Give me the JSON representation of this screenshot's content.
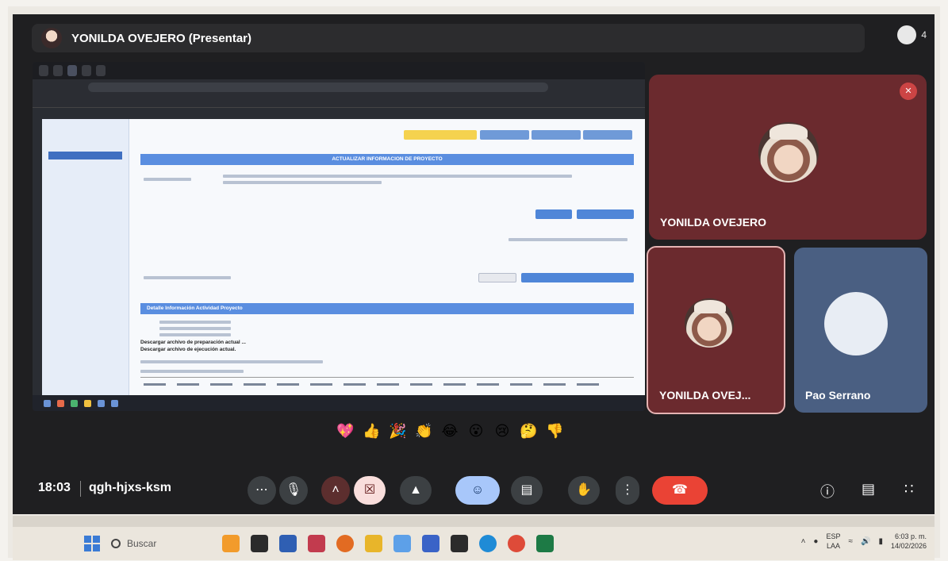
{
  "header": {
    "presenter_label": "YONILDA OVEJERO (Presentar)",
    "people_count": "4"
  },
  "shared_screen": {
    "banner_title": "ACTUALIZAR INFORMACION DE PROYECTO",
    "section_title": "Detalle Información Actividad Proyecto",
    "download_prep": "Descargar archivo de preparación actual ...",
    "download_exec": "Descargar archivo de ejecución actual."
  },
  "participants": [
    {
      "name": "YONILDA OVEJERO"
    },
    {
      "name": "YONILDA OVEJ..."
    },
    {
      "name": "Pao Serrano"
    }
  ],
  "reactions": [
    "💖",
    "👍",
    "🎉",
    "👏",
    "😂",
    "😮",
    "😢",
    "🤔",
    "👎"
  ],
  "bottombar": {
    "clock": "18:03",
    "meeting_code": "qgh-hjxs-ksm"
  },
  "taskbar": {
    "search_placeholder": "Buscar",
    "lang_line1": "ESP",
    "lang_line2": "LAA",
    "time": "6:03 p. m.",
    "date": "14/02/2026"
  },
  "colors": {
    "tile_maroon": "#6b2a2e",
    "tile_blue": "#4a5f82",
    "hangup_red": "#ea4335",
    "reaction_blue": "#a8c7fa"
  }
}
